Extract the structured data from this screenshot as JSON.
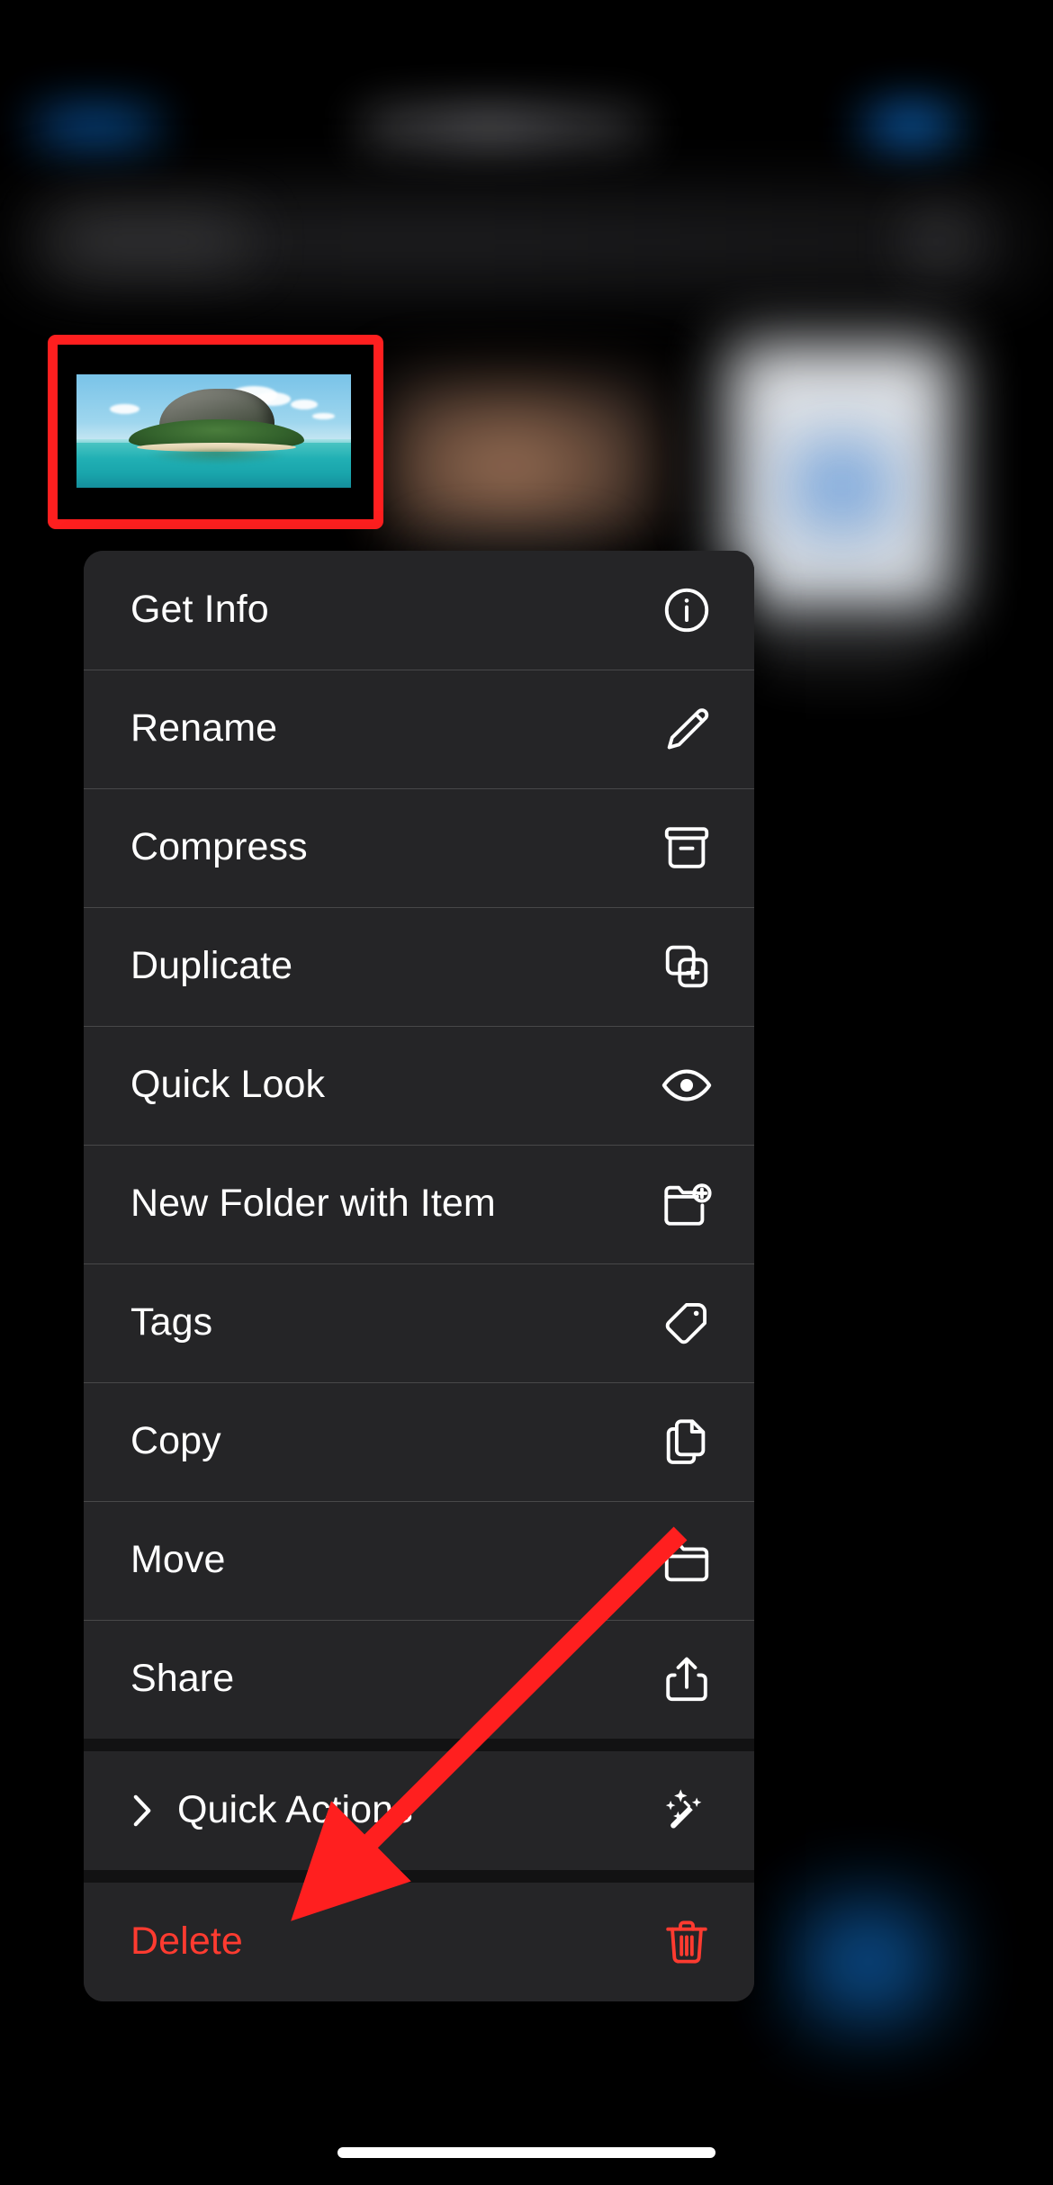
{
  "app": {
    "platform": "iOS Files",
    "background_blurred": true
  },
  "navbar": {
    "left_button": "",
    "title": "",
    "right_button": ""
  },
  "search": {
    "placeholder": ""
  },
  "selection": {
    "highlight_color": "#ff1f1f",
    "item_kind": "image-thumbnail",
    "item_description": "tropical island photo"
  },
  "context_menu": {
    "groups": [
      {
        "items": [
          {
            "label": "Get Info",
            "icon": "info-circle-icon",
            "destructive": false,
            "submenu": false
          },
          {
            "label": "Rename",
            "icon": "pencil-icon",
            "destructive": false,
            "submenu": false
          },
          {
            "label": "Compress",
            "icon": "archivebox-icon",
            "destructive": false,
            "submenu": false
          },
          {
            "label": "Duplicate",
            "icon": "duplicate-icon",
            "destructive": false,
            "submenu": false
          },
          {
            "label": "Quick Look",
            "icon": "eye-icon",
            "destructive": false,
            "submenu": false
          },
          {
            "label": "New Folder with Item",
            "icon": "folder-plus-icon",
            "destructive": false,
            "submenu": false
          },
          {
            "label": "Tags",
            "icon": "tag-icon",
            "destructive": false,
            "submenu": false
          },
          {
            "label": "Copy",
            "icon": "copy-docs-icon",
            "destructive": false,
            "submenu": false
          },
          {
            "label": "Move",
            "icon": "folder-icon",
            "destructive": false,
            "submenu": false
          },
          {
            "label": "Share",
            "icon": "share-icon",
            "destructive": false,
            "submenu": false
          }
        ]
      },
      {
        "items": [
          {
            "label": "Quick Actions",
            "icon": "magic-wand-icon",
            "destructive": false,
            "submenu": true
          }
        ]
      },
      {
        "items": [
          {
            "label": "Delete",
            "icon": "trash-icon",
            "destructive": true,
            "submenu": false
          }
        ]
      }
    ]
  },
  "annotation": {
    "type": "arrow",
    "color": "#ff1f1f",
    "points_to": "Delete"
  },
  "colors": {
    "menu_background": "#252527",
    "destructive": "#ff3b30",
    "annotation_red": "#ff1f1f",
    "screen_background": "#000000"
  }
}
